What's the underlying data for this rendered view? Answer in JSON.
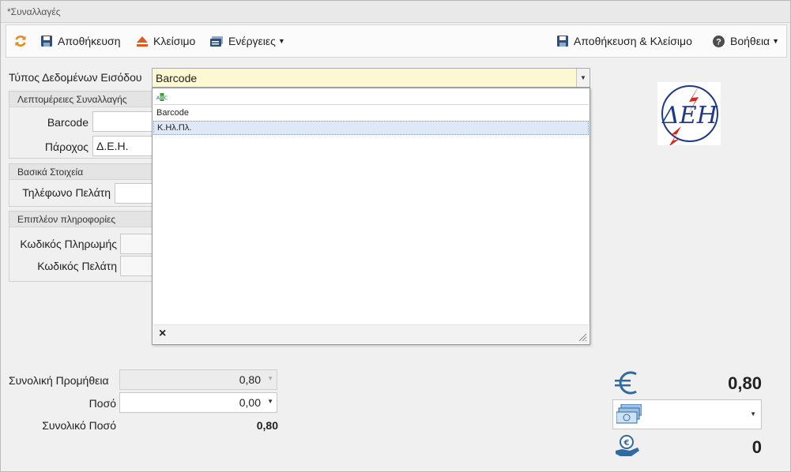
{
  "window": {
    "title": "*Συναλλαγές"
  },
  "toolbar": {
    "refresh_icon": "refresh-icon",
    "save_label": "Αποθήκευση",
    "close_label": "Κλείσιμο",
    "actions_label": "Ενέργειες",
    "save_close_label": "Αποθήκευση & Κλείσιμο",
    "help_label": "Βοήθεια"
  },
  "form": {
    "input_type_label": "Τύπος Δεδομένων Εισόδου",
    "input_type_value": "Barcode",
    "dropdown": {
      "filter_icon": "abc-icon",
      "filter_icon_text": "ABC",
      "options": [
        "Barcode",
        "Κ.Ηλ.Πλ."
      ],
      "close_glyph": "×"
    },
    "group_details": {
      "title": "Λεπτομέρειες Συναλλαγής",
      "barcode_label": "Barcode",
      "barcode_value": "",
      "provider_label": "Πάροχος",
      "provider_value": "Δ.Ε.Η."
    },
    "group_basic": {
      "title": "Βασικά Στοιχεία",
      "phone_label": "Τηλέφωνο Πελάτη",
      "phone_value": ""
    },
    "group_extra": {
      "title": "Επιπλέον πληροφορίες",
      "payment_code_label": "Κωδικός Πληρωμής",
      "customer_code_label": "Κωδικός Πελάτη"
    },
    "totals": {
      "commission_label": "Συνολική Προμήθεια",
      "commission_value": "0,80",
      "amount_label": "Ποσό",
      "amount_value": "0,00",
      "total_label": "Συνολικό Ποσό",
      "total_value": "0,80"
    }
  },
  "summary": {
    "euro_amount": "0,80",
    "payment_method_value": "",
    "coins_value": "0"
  },
  "logo": {
    "text": "ΔΕΗ"
  },
  "colors": {
    "logo_red": "#d42a1d",
    "logo_blue": "#1d3a8a",
    "icon_blue": "#2f6aa3",
    "combo_bg": "#fcf8d2"
  }
}
